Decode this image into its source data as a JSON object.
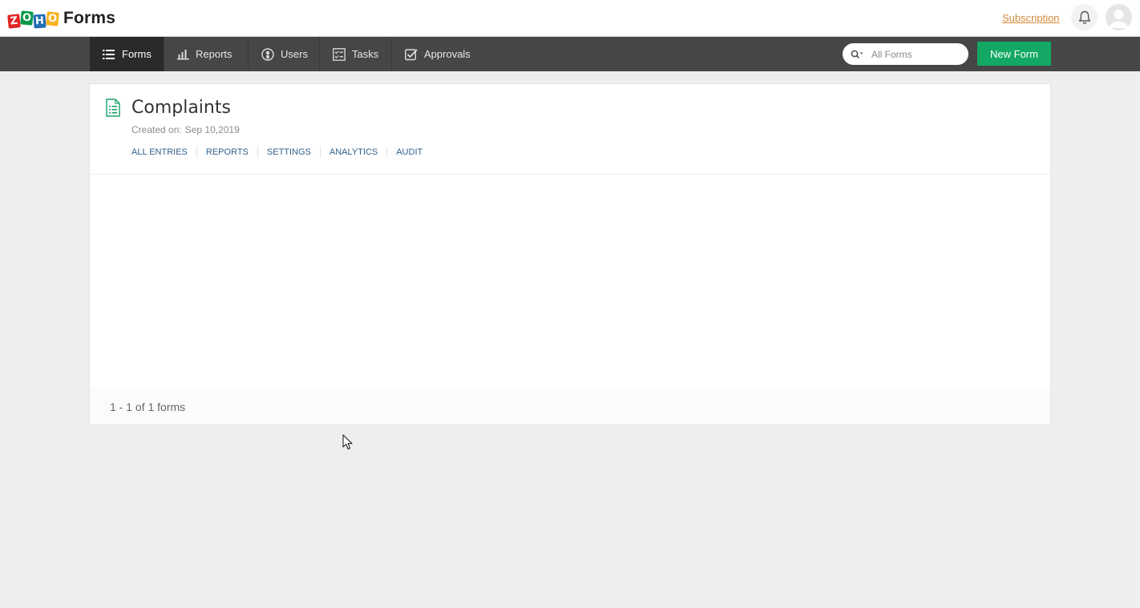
{
  "header": {
    "app_name": "Forms",
    "logo_letters": [
      "Z",
      "O",
      "H",
      "O"
    ],
    "subscription_label": "Subscription",
    "icons": {
      "notifications": "bell-icon",
      "profile": "avatar-icon"
    }
  },
  "nav": {
    "items": [
      {
        "label": "Forms",
        "icon": "list-icon",
        "active": true
      },
      {
        "label": "Reports",
        "icon": "bar-chart-icon",
        "active": false
      },
      {
        "label": "Users",
        "icon": "user-circle-icon",
        "active": false
      },
      {
        "label": "Tasks",
        "icon": "checklist-icon",
        "active": false
      },
      {
        "label": "Approvals",
        "icon": "check-square-icon",
        "active": false
      }
    ],
    "search_placeholder": "All Forms",
    "new_form_label": "New Form"
  },
  "forms": [
    {
      "title": "Complaints",
      "created_label": "Created on:",
      "created_date": "Sep 10,2019",
      "links": [
        "ALL ENTRIES",
        "REPORTS",
        "SETTINGS",
        "ANALYTICS",
        "AUDIT"
      ]
    }
  ],
  "pagination": {
    "summary": "1 - 1 of 1 forms"
  },
  "colors": {
    "nav_bg": "#464646",
    "nav_active": "#2a2a2a",
    "primary_button": "#13a863",
    "link": "#2f5f8a",
    "subscription": "#d6893b"
  }
}
